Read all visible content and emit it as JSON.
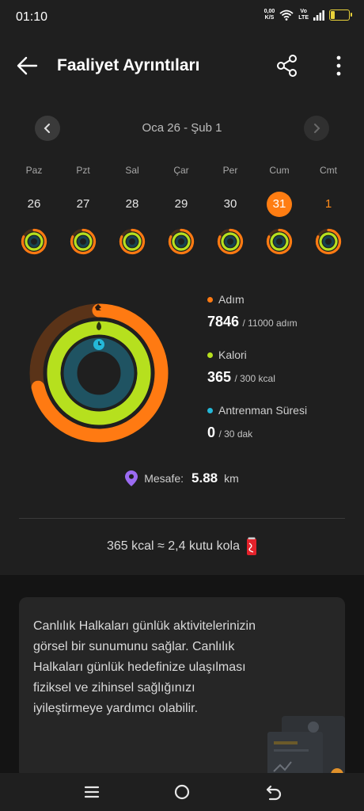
{
  "status": {
    "time": "01:10",
    "speed_value": "0,00",
    "speed_unit": "K/S",
    "volte_top": "Vo",
    "volte_bottom": "LTE",
    "battery": "22",
    "battery_fraction": 0.22
  },
  "header": {
    "title": "Faaliyet Ayrıntıları"
  },
  "date_nav": {
    "range": "Oca 26 - Şub 1"
  },
  "week": [
    {
      "name": "Paz",
      "num": "26",
      "state": "normal"
    },
    {
      "name": "Pzt",
      "num": "27",
      "state": "normal"
    },
    {
      "name": "Sal",
      "num": "28",
      "state": "normal"
    },
    {
      "name": "Çar",
      "num": "29",
      "state": "normal"
    },
    {
      "name": "Per",
      "num": "30",
      "state": "normal"
    },
    {
      "name": "Cum",
      "num": "31",
      "state": "selected"
    },
    {
      "name": "Cmt",
      "num": "1",
      "state": "today"
    }
  ],
  "stats": {
    "steps": {
      "label": "Adım",
      "value": "7846",
      "goal": "/ 11000 adım",
      "progress": 0.713,
      "color": "#ff7a12"
    },
    "calories": {
      "label": "Kalori",
      "value": "365",
      "goal": "/ 300 kcal",
      "progress": 1.0,
      "color": "#b6e01e"
    },
    "workout": {
      "label": "Antrenman Süresi",
      "value": "0",
      "goal": "/ 30 dak",
      "progress": 0.0,
      "color": "#24b8d8"
    }
  },
  "distance": {
    "label": "Mesafe:",
    "value": "5.88",
    "unit": "km"
  },
  "kcal_equiv": {
    "text": "365 kcal ≈ 2,4 kutu kola"
  },
  "info": {
    "text": "Canlılık Halkaları günlük aktivitelerinizin görsel bir sunumunu sağlar. Canlılık Halkaları günlük hedefinize ulaşılması fiziksel ve zihinsel sağlığınızı iyileştirmeye yardımcı olabilir."
  },
  "colors": {
    "accent": "#ff7d12",
    "steps": "#ff7a12",
    "calories": "#b6e01e",
    "workout": "#24b8d8",
    "distance_pin": "#9b6bf2"
  },
  "icons": {
    "back": "arrow-left-icon",
    "share": "share-icon",
    "more": "more-vertical-icon",
    "prev": "chevron-left-icon",
    "next": "chevron-right-icon",
    "pin": "location-pin-icon",
    "cola": "cola-can-icon"
  }
}
